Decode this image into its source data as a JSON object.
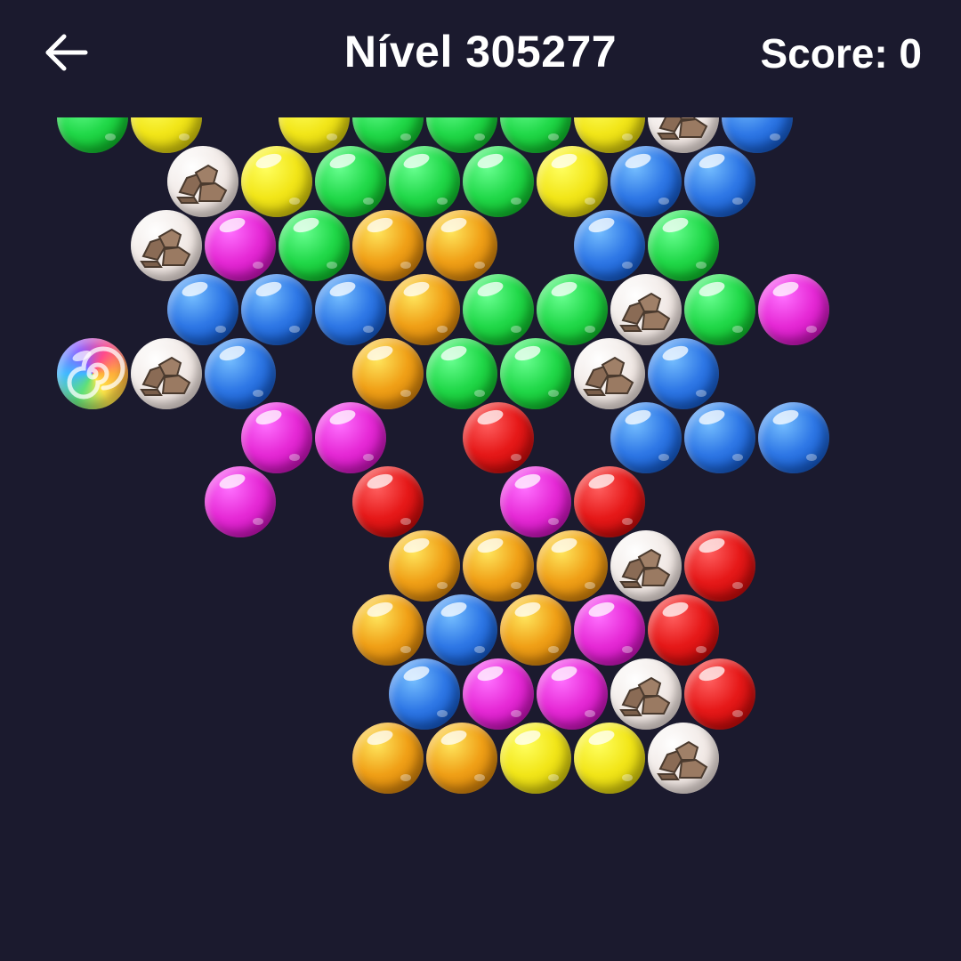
{
  "header": {
    "back_icon": "arrow-left-icon",
    "title": "Nível 305277",
    "score": "Score: 0"
  },
  "colors": {
    "background": "#1b1a2e",
    "green": "#22d94a",
    "yellow": "#f2e619",
    "blue": "#2f78e6",
    "magenta": "#e62ad6",
    "orange": "#f0a017",
    "red": "#e61919",
    "rock": "#efe6e2"
  },
  "board": {
    "bubbles": [
      {
        "color": "green",
        "row": 0,
        "col": 0
      },
      {
        "color": "yellow",
        "row": 0,
        "col": 1
      },
      {
        "color": "yellow",
        "row": 0,
        "col": 3
      },
      {
        "color": "green",
        "row": 0,
        "col": 4
      },
      {
        "color": "green",
        "row": 0,
        "col": 5
      },
      {
        "color": "green",
        "row": 0,
        "col": 6
      },
      {
        "color": "yellow",
        "row": 0,
        "col": 7
      },
      {
        "color": "rock",
        "row": 0,
        "col": 8
      },
      {
        "color": "blue",
        "row": 0,
        "col": 9
      },
      {
        "color": "rock",
        "row": 1,
        "col": 1
      },
      {
        "color": "yellow",
        "row": 1,
        "col": 2
      },
      {
        "color": "green",
        "row": 1,
        "col": 3
      },
      {
        "color": "green",
        "row": 1,
        "col": 4
      },
      {
        "color": "green",
        "row": 1,
        "col": 5
      },
      {
        "color": "yellow",
        "row": 1,
        "col": 6
      },
      {
        "color": "blue",
        "row": 1,
        "col": 7
      },
      {
        "color": "blue",
        "row": 1,
        "col": 8
      },
      {
        "color": "rock",
        "row": 2,
        "col": 1
      },
      {
        "color": "magenta",
        "row": 2,
        "col": 2
      },
      {
        "color": "green",
        "row": 2,
        "col": 3
      },
      {
        "color": "orange",
        "row": 2,
        "col": 4
      },
      {
        "color": "orange",
        "row": 2,
        "col": 5
      },
      {
        "color": "blue",
        "row": 2,
        "col": 7
      },
      {
        "color": "green",
        "row": 2,
        "col": 8
      },
      {
        "color": "blue",
        "row": 3,
        "col": 1
      },
      {
        "color": "blue",
        "row": 3,
        "col": 2
      },
      {
        "color": "blue",
        "row": 3,
        "col": 3
      },
      {
        "color": "orange",
        "row": 3,
        "col": 4
      },
      {
        "color": "green",
        "row": 3,
        "col": 5
      },
      {
        "color": "green",
        "row": 3,
        "col": 6
      },
      {
        "color": "rock",
        "row": 3,
        "col": 7
      },
      {
        "color": "green",
        "row": 3,
        "col": 8
      },
      {
        "color": "magenta",
        "row": 3,
        "col": 9
      },
      {
        "color": "rainbow",
        "row": 4,
        "col": 0
      },
      {
        "color": "rock",
        "row": 4,
        "col": 1
      },
      {
        "color": "blue",
        "row": 4,
        "col": 2
      },
      {
        "color": "orange",
        "row": 4,
        "col": 4
      },
      {
        "color": "green",
        "row": 4,
        "col": 5
      },
      {
        "color": "green",
        "row": 4,
        "col": 6
      },
      {
        "color": "rock",
        "row": 4,
        "col": 7
      },
      {
        "color": "blue",
        "row": 4,
        "col": 8
      },
      {
        "color": "magenta",
        "row": 5,
        "col": 2
      },
      {
        "color": "magenta",
        "row": 5,
        "col": 3
      },
      {
        "color": "red",
        "row": 5,
        "col": 5
      },
      {
        "color": "blue",
        "row": 5,
        "col": 7
      },
      {
        "color": "blue",
        "row": 5,
        "col": 8
      },
      {
        "color": "blue",
        "row": 5,
        "col": 9
      },
      {
        "color": "magenta",
        "row": 6,
        "col": 2
      },
      {
        "color": "red",
        "row": 6,
        "col": 4
      },
      {
        "color": "magenta",
        "row": 6,
        "col": 6
      },
      {
        "color": "red",
        "row": 6,
        "col": 7
      },
      {
        "color": "orange",
        "row": 7,
        "col": 4
      },
      {
        "color": "orange",
        "row": 7,
        "col": 5
      },
      {
        "color": "orange",
        "row": 7,
        "col": 6
      },
      {
        "color": "rock",
        "row": 7,
        "col": 7
      },
      {
        "color": "red",
        "row": 7,
        "col": 8
      },
      {
        "color": "orange",
        "row": 8,
        "col": 4
      },
      {
        "color": "blue",
        "row": 8,
        "col": 5
      },
      {
        "color": "orange",
        "row": 8,
        "col": 6
      },
      {
        "color": "magenta",
        "row": 8,
        "col": 7
      },
      {
        "color": "red",
        "row": 8,
        "col": 8
      },
      {
        "color": "blue",
        "row": 9,
        "col": 4
      },
      {
        "color": "magenta",
        "row": 9,
        "col": 5
      },
      {
        "color": "magenta",
        "row": 9,
        "col": 6
      },
      {
        "color": "rock",
        "row": 9,
        "col": 7
      },
      {
        "color": "red",
        "row": 9,
        "col": 8
      },
      {
        "color": "orange",
        "row": 10,
        "col": 4
      },
      {
        "color": "orange",
        "row": 10,
        "col": 5
      },
      {
        "color": "yellow",
        "row": 10,
        "col": 6
      },
      {
        "color": "yellow",
        "row": 10,
        "col": 7
      },
      {
        "color": "rock",
        "row": 10,
        "col": 8
      }
    ]
  }
}
